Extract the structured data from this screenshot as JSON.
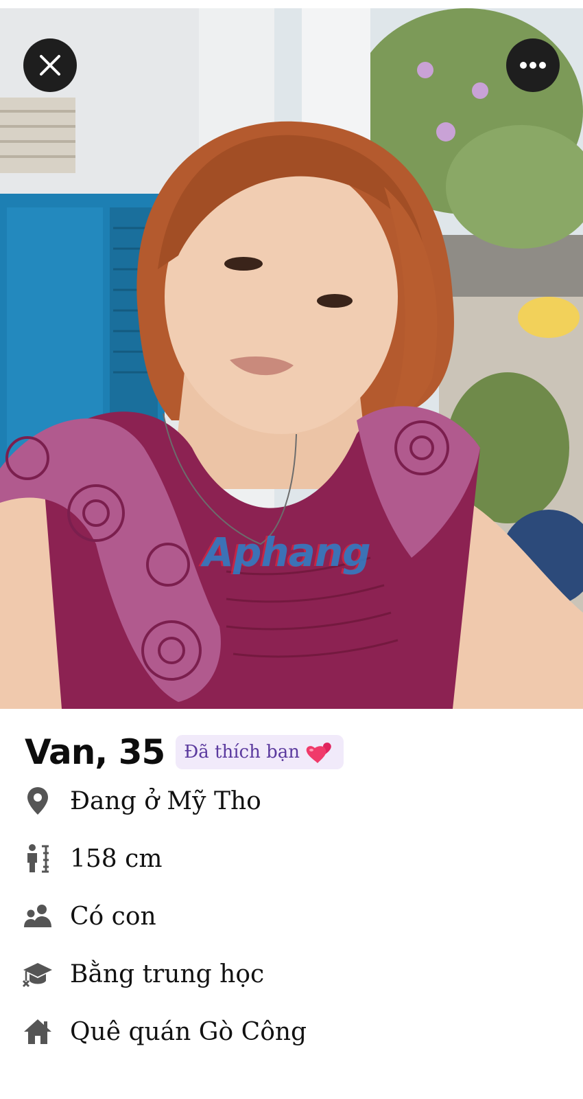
{
  "photo": {
    "alt": "profile-photo",
    "watermark": "Aphang"
  },
  "controls": {
    "close_icon": "close-icon",
    "more_icon": "more-options-icon"
  },
  "profile": {
    "name_age": "Van, 35",
    "liked_badge": "Đã thích bạn",
    "liked_icon": "hearts-icon",
    "accent_color": "#5b3a9e",
    "badge_bg": "#f1eafa"
  },
  "details": [
    {
      "icon": "location-pin-icon",
      "text": "Đang ở Mỹ Tho"
    },
    {
      "icon": "height-icon",
      "text": "158 cm"
    },
    {
      "icon": "children-icon",
      "text": "Có con"
    },
    {
      "icon": "education-cap-icon",
      "text": "Bằng trung học"
    },
    {
      "icon": "home-icon",
      "text": "Quê quán Gò Công"
    }
  ]
}
